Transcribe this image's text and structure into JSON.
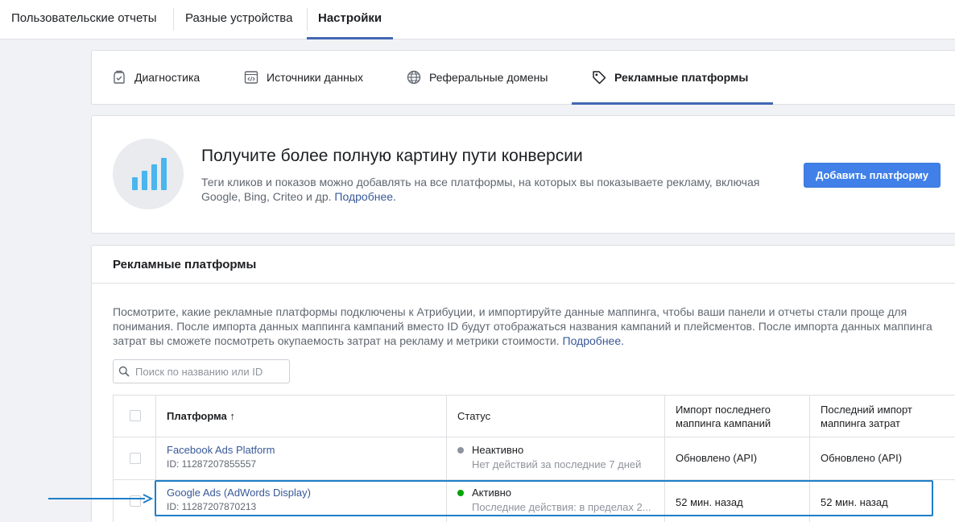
{
  "top_tabs": [
    "Пользовательские отчеты",
    "Разные устройства",
    "Настройки"
  ],
  "sub_tabs": [
    "Диагностика",
    "Источники данных",
    "Реферальные домены",
    "Рекламные платформы"
  ],
  "promo": {
    "title": "Получите более полную картину пути конверсии",
    "desc": "Теги кликов и показов можно добавлять на все платформы, на которых вы показываете рекламу, включая Google, Bing, Criteo и др.",
    "more": "Подробнее.",
    "button": "Добавить платформу"
  },
  "platforms": {
    "title": "Рекламные платформы",
    "desc": "Посмотрите, какие рекламные платформы подключены к Атрибуции, и импортируйте данные маппинга, чтобы ваши панели и отчеты стали проще для понимания. После импорта данных маппинга кампаний вместо ID будут отображаться названия кампаний и плейсментов. После импорта данных маппинга затрат вы сможете посмотреть окупаемость затрат на рекламу и метрики стоимости.",
    "more": "Подробнее.",
    "search_placeholder": "Поиск по названию или ID",
    "columns": {
      "platform": "Платформа ↑",
      "status": "Статус",
      "campaign_import": "Импорт последнего маппинга кампаний",
      "cost_import": "Последний импорт маппинга затрат"
    },
    "rows": [
      {
        "name": "Facebook Ads Platform",
        "id": "ID: 11287207855557",
        "status": "Неактивно",
        "status_detail": "Нет действий за последние 7 дней",
        "status_color": "#8d949e",
        "campaign_import": "Обновлено (API)",
        "cost_import": "Обновлено (API)"
      },
      {
        "name": "Google Ads (AdWords Display)",
        "id": "ID: 11287207870213",
        "status": "Активно",
        "status_detail": "Последние действия: в пределах 2...",
        "status_color": "#00a400",
        "campaign_import": "52 мин. назад",
        "cost_import": "52 мин. назад"
      }
    ]
  },
  "colors": {
    "accent": "#4267b2",
    "button": "#4080e8",
    "highlight": "#1f7ec7"
  }
}
